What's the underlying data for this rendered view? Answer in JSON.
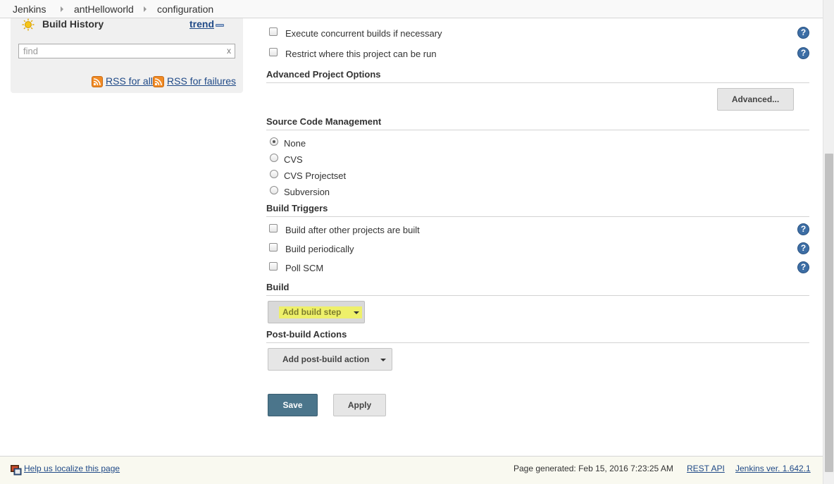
{
  "breadcrumb": {
    "items": [
      {
        "label": "Jenkins"
      },
      {
        "label": "antHelloworld"
      },
      {
        "label": "configuration"
      }
    ]
  },
  "sidebar": {
    "build_history_title": "Build History",
    "trend_label": "trend",
    "search": {
      "placeholder": "find",
      "value": "",
      "clear_label": "x"
    },
    "rss_all_label": "RSS for all",
    "rss_failures_label": "RSS for failures"
  },
  "general_options": [
    {
      "label": "Execute concurrent builds if necessary",
      "checked": false
    },
    {
      "label": "Restrict where this project can be run",
      "checked": false
    }
  ],
  "advanced_project_options": {
    "title": "Advanced Project Options",
    "button_label": "Advanced..."
  },
  "source_code_management": {
    "title": "Source Code Management",
    "options": [
      {
        "label": "None",
        "selected": true
      },
      {
        "label": "CVS",
        "selected": false
      },
      {
        "label": "CVS Projectset",
        "selected": false
      },
      {
        "label": "Subversion",
        "selected": false
      }
    ]
  },
  "build_triggers": {
    "title": "Build Triggers",
    "options": [
      {
        "label": "Build after other projects are built",
        "checked": false
      },
      {
        "label": "Build periodically",
        "checked": false
      },
      {
        "label": "Poll SCM",
        "checked": false
      }
    ]
  },
  "build": {
    "title": "Build",
    "add_step_label": "Add build step",
    "highlight_color": "#eef06a"
  },
  "post_build": {
    "title": "Post-build Actions",
    "add_action_label": "Add post-build action"
  },
  "actions": {
    "save_label": "Save",
    "apply_label": "Apply"
  },
  "footer": {
    "localize_label": "Help us localize this page",
    "page_generated": "Page generated: Feb 15, 2016 7:23:25 AM",
    "rest_api_label": "REST API",
    "version_label": "Jenkins ver. 1.642.1"
  },
  "icons": {
    "help": "help-icon",
    "rss": "rss-icon",
    "build_history": "sun-icon",
    "localize": "localize-icon"
  },
  "colors": {
    "save_button": "#4b758b",
    "link": "#204a87",
    "help_icon": "#3d6ea5",
    "rss_icon": "#f08a24"
  }
}
